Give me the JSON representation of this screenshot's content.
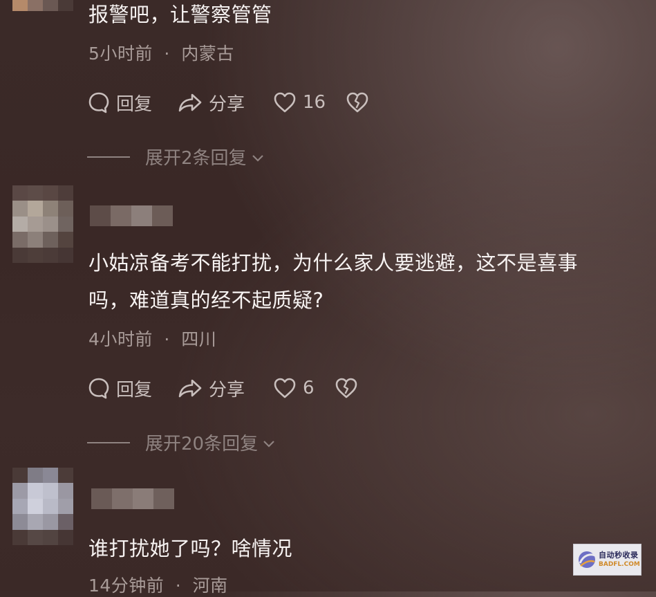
{
  "comments": [
    {
      "text": "报警吧，让警察管管",
      "time": "5小时前",
      "separator": "·",
      "location": "内蒙古",
      "reply_label": "回复",
      "share_label": "分享",
      "likes": "16",
      "expand_label": "展开2条回复"
    },
    {
      "text_line1": "小姑凉备考不能打扰，为什么家人要逃避，这不是喜事",
      "text_line2": "吗，难道真的经不起质疑?",
      "time": "4小时前",
      "separator": "·",
      "location": "四川",
      "reply_label": "回复",
      "share_label": "分享",
      "likes": "6",
      "expand_label": "展开20条回复"
    },
    {
      "text": "谁打扰她了吗？啥情况",
      "time": "14分钟前",
      "separator": "·",
      "location": "河南"
    }
  ],
  "icons": {
    "reply": "speech-bubble-icon",
    "share": "share-arrow-icon",
    "like": "heart-icon",
    "dislike": "broken-heart-icon",
    "expand": "chevron-down-icon"
  },
  "colors": {
    "background": "#3b2a28",
    "text": "#f7f3f2",
    "meta": "#a99c99",
    "action": "#c9bfbd",
    "expand": "#8f8381"
  },
  "watermark": {
    "cn": "自动秒收录",
    "en": "BADFL.COM"
  }
}
